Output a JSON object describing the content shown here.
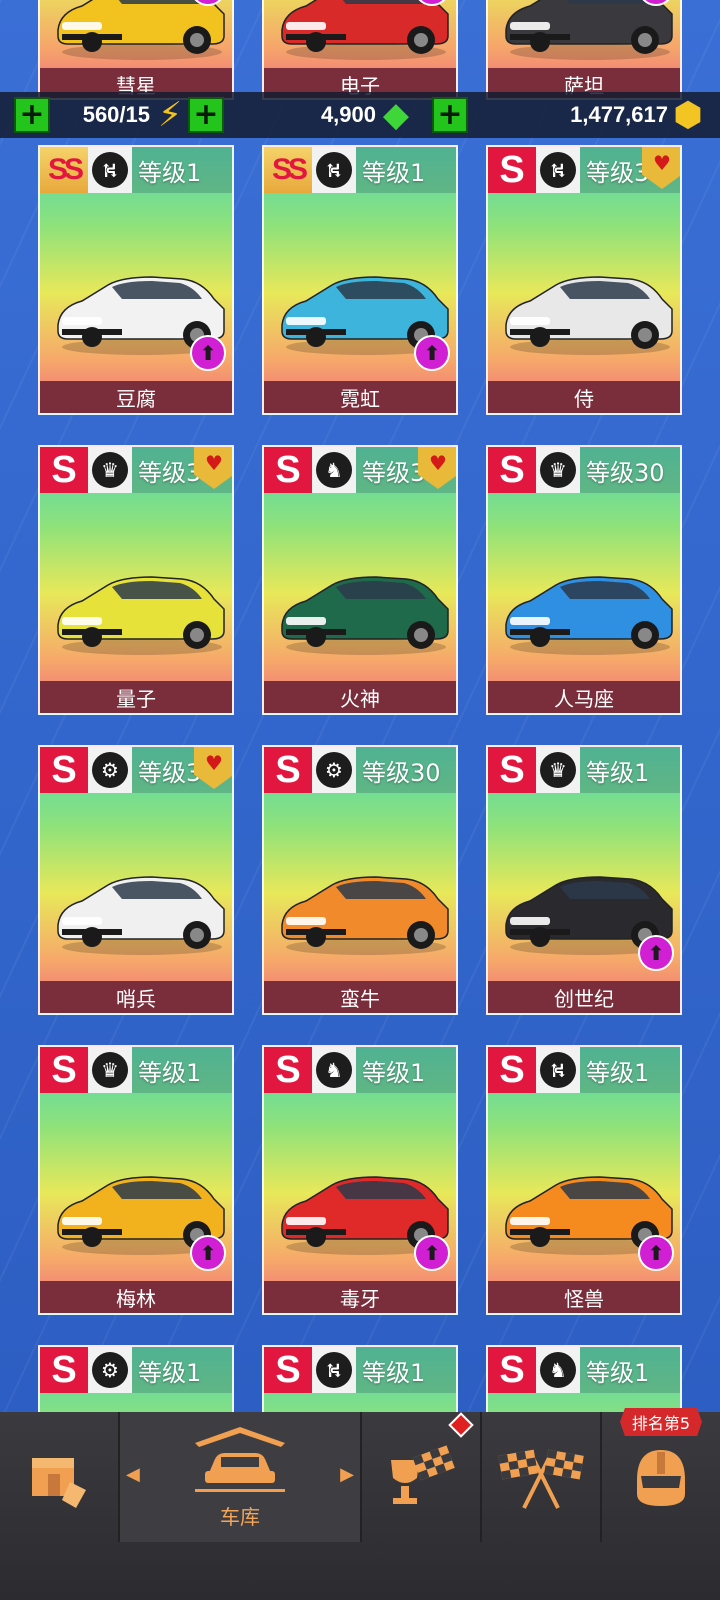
{
  "resources": {
    "energy": "560/15",
    "gems": "4,900",
    "coins": "1,477,617"
  },
  "partial_top_cards": [
    {
      "name": "彗星"
    },
    {
      "name": "电子"
    },
    {
      "name": "萨坦"
    }
  ],
  "cards": [
    {
      "tier": "SS",
      "class_icon": "road-icon",
      "level": "等级1",
      "name": "豆腐",
      "favorite": false,
      "upgrade": true,
      "color": "#f2f2f2"
    },
    {
      "tier": "SS",
      "class_icon": "road-icon",
      "level": "等级1",
      "name": "霓虹",
      "favorite": false,
      "upgrade": true,
      "color": "#3cb4dc"
    },
    {
      "tier": "S",
      "class_icon": "road-icon",
      "level": "等级3",
      "name": "侍",
      "favorite": true,
      "upgrade": false,
      "color": "#e8e8e8"
    },
    {
      "tier": "S",
      "class_icon": "crown-icon",
      "level": "等级3",
      "name": "量子",
      "favorite": true,
      "upgrade": false,
      "color": "#e6e23a"
    },
    {
      "tier": "S",
      "class_icon": "horse-icon",
      "level": "等级3",
      "name": "火神",
      "favorite": true,
      "upgrade": false,
      "color": "#1e6a4a"
    },
    {
      "tier": "S",
      "class_icon": "crown-icon",
      "level": "等级30",
      "name": "人马座",
      "favorite": false,
      "upgrade": false,
      "color": "#2f8fe0"
    },
    {
      "tier": "S",
      "class_icon": "wheel-icon",
      "level": "等级3",
      "name": "哨兵",
      "favorite": true,
      "upgrade": false,
      "color": "#f0f0f0"
    },
    {
      "tier": "S",
      "class_icon": "wheel-icon",
      "level": "等级30",
      "name": "蛮牛",
      "favorite": false,
      "upgrade": false,
      "color": "#f08a2a"
    },
    {
      "tier": "S",
      "class_icon": "crown-icon",
      "level": "等级1",
      "name": "创世纪",
      "favorite": false,
      "upgrade": true,
      "color": "#2a2a2e"
    },
    {
      "tier": "S",
      "class_icon": "crown-icon",
      "level": "等级1",
      "name": "梅林",
      "favorite": false,
      "upgrade": true,
      "color": "#f2b21e"
    },
    {
      "tier": "S",
      "class_icon": "horse-icon",
      "level": "等级1",
      "name": "毒牙",
      "favorite": false,
      "upgrade": true,
      "color": "#e02a2a"
    },
    {
      "tier": "S",
      "class_icon": "road-icon",
      "level": "等级1",
      "name": "怪兽",
      "favorite": false,
      "upgrade": true,
      "color": "#f58a1e"
    },
    {
      "tier": "S",
      "class_icon": "wheel-icon",
      "level": "等级1",
      "name": "",
      "favorite": false,
      "upgrade": false,
      "color": "#cccccc"
    },
    {
      "tier": "S",
      "class_icon": "road-icon",
      "level": "等级1",
      "name": "",
      "favorite": false,
      "upgrade": false,
      "color": "#cccccc"
    },
    {
      "tier": "S",
      "class_icon": "horse-icon",
      "level": "等级1",
      "name": "",
      "favorite": false,
      "upgrade": false,
      "color": "#cccccc"
    }
  ],
  "nav": {
    "items": [
      {
        "name": "shop",
        "label": ""
      },
      {
        "name": "garage",
        "label": "车库"
      },
      {
        "name": "events",
        "label": ""
      },
      {
        "name": "race",
        "label": ""
      },
      {
        "name": "profile",
        "label": ""
      }
    ],
    "rank_badge": "排名第5"
  }
}
